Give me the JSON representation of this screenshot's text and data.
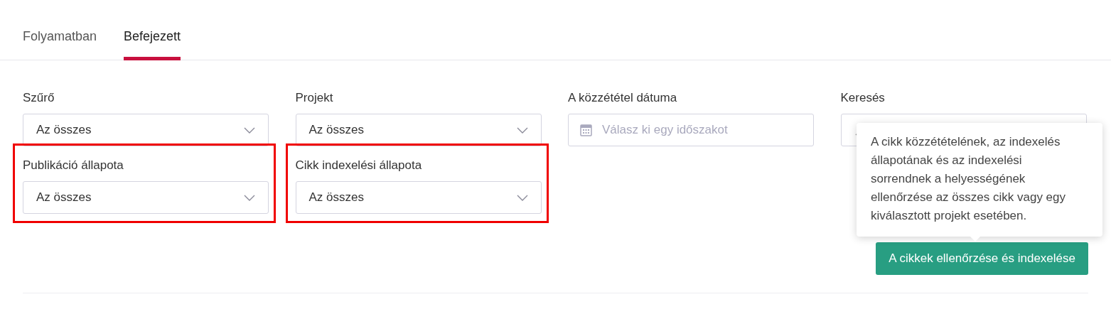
{
  "tabs": [
    {
      "label": "Folyamatban",
      "selected": false
    },
    {
      "label": "Befejezett",
      "selected": true
    }
  ],
  "filters": [
    {
      "kind": "select",
      "label": "Szűrő",
      "value": "Az összes",
      "highlighted": false
    },
    {
      "kind": "select",
      "label": "Projekt",
      "value": "Az összes",
      "highlighted": false
    },
    {
      "kind": "date",
      "label": "A közzététel dátuma",
      "placeholder": "Válasz ki egy időszakot",
      "highlighted": false
    },
    {
      "kind": "search",
      "label": "Keresés",
      "highlighted": false
    },
    {
      "kind": "select",
      "label": "Publikáció állapota",
      "value": "Az összes",
      "highlighted": true
    },
    {
      "kind": "select",
      "label": "Cikk indexelési állapota",
      "value": "Az összes",
      "highlighted": true
    }
  ],
  "tooltip": {
    "text": "A cikk közzétételének, az indexelés állapotának és az indexelési sorrendnek a helyességének ellenőrzése az összes cikk vagy egy kiválasztott projekt esetében."
  },
  "action_button": {
    "label": "A cikkek ellenőrzése és indexelése"
  }
}
